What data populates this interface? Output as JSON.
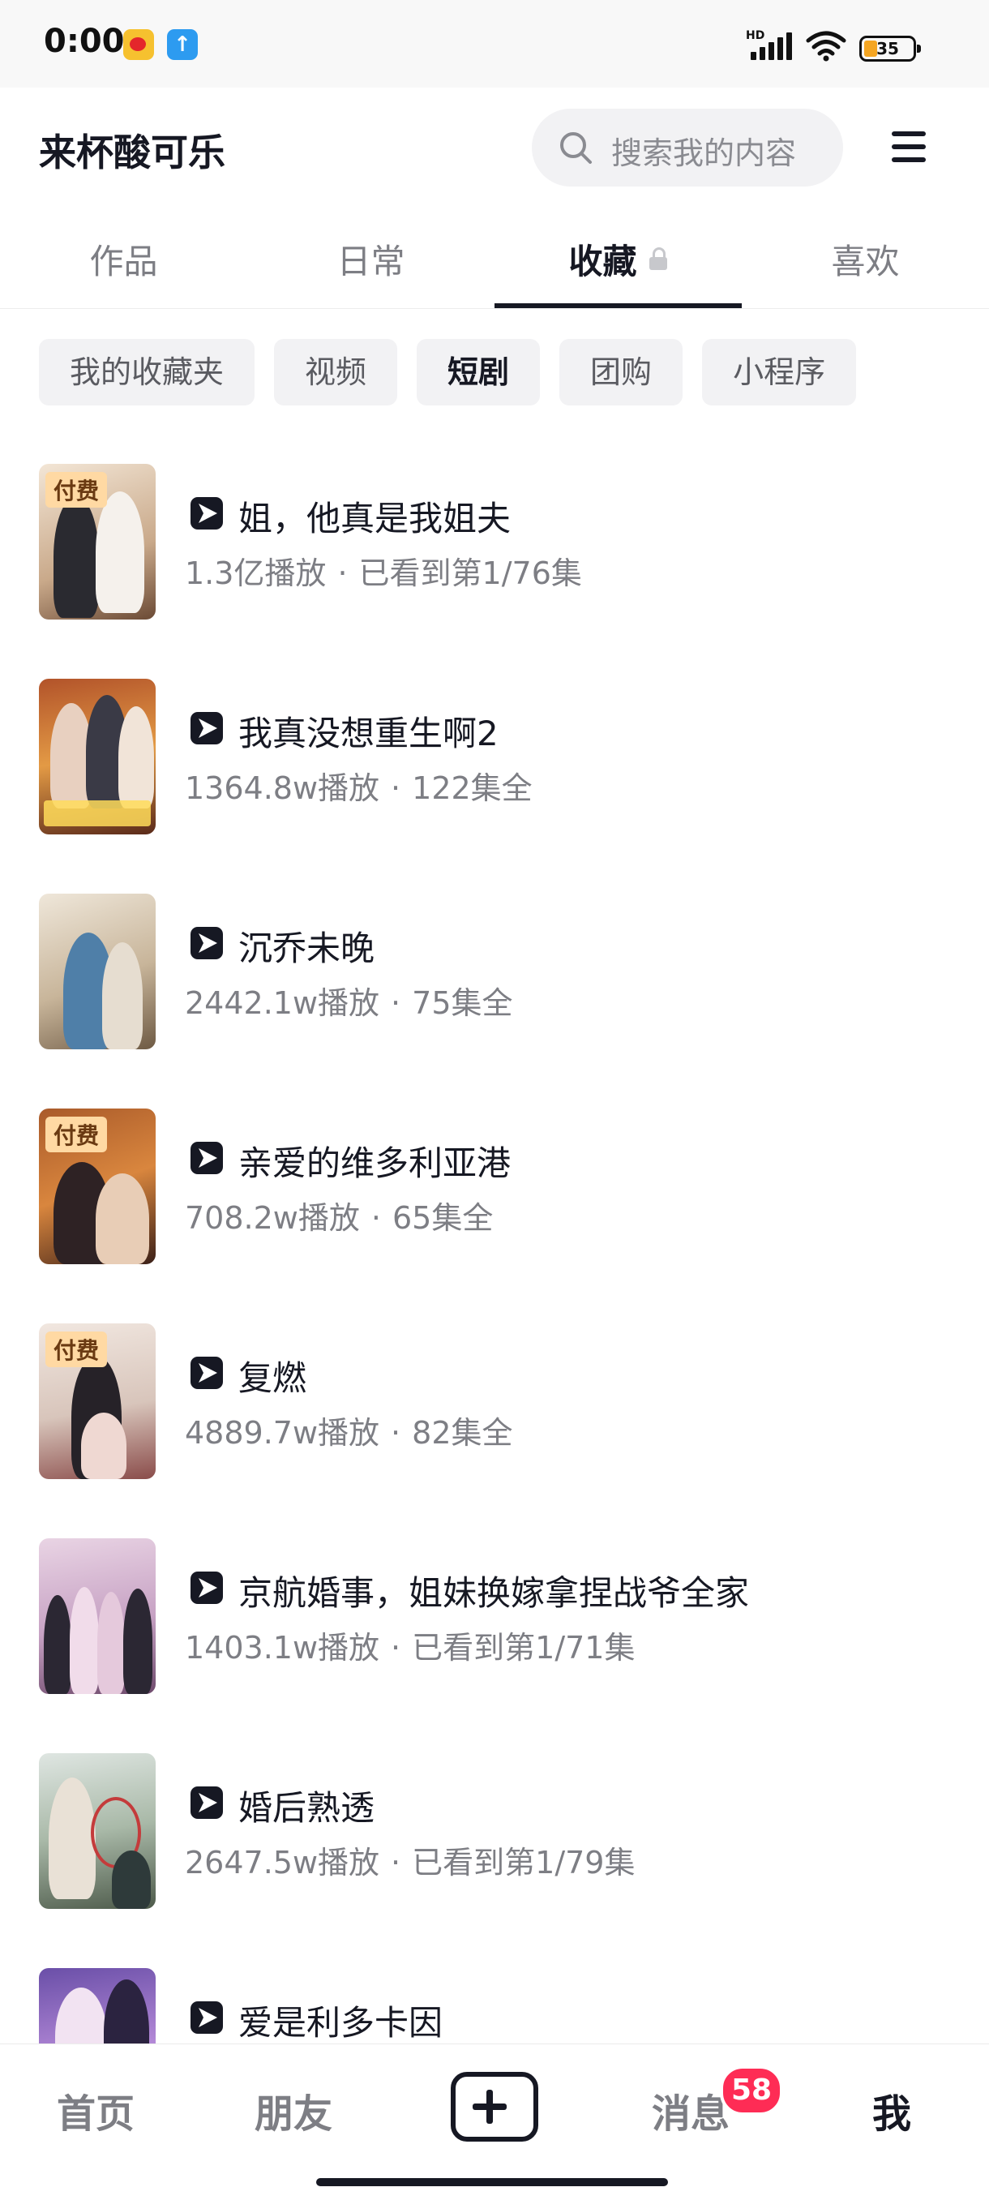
{
  "status_bar": {
    "time": "0:00",
    "network_label": "HD",
    "battery_level": "35",
    "icons": [
      "weibo-icon",
      "upload-icon",
      "signal-icon",
      "wifi-icon",
      "battery-icon"
    ]
  },
  "header": {
    "profile_name": "来杯酸可乐",
    "search_placeholder": "搜索我的内容",
    "menu_icon": "menu-icon"
  },
  "tabs": [
    {
      "label": "作品",
      "active": false
    },
    {
      "label": "日常",
      "active": false
    },
    {
      "label": "收藏",
      "active": true,
      "icon": "lock-icon"
    },
    {
      "label": "喜欢",
      "active": false
    }
  ],
  "filters": [
    {
      "label": "我的收藏夹",
      "selected": false
    },
    {
      "label": "视频",
      "selected": false
    },
    {
      "label": "短剧",
      "selected": true
    },
    {
      "label": "团购",
      "selected": false
    },
    {
      "label": "小程序",
      "selected": false
    }
  ],
  "paid_label": "付费",
  "meta_separator": "·",
  "dramas": [
    {
      "title": "姐，他真是我姐夫",
      "plays": "1.3亿播放",
      "progress": "已看到第1/76集",
      "paid": true
    },
    {
      "title": "我真没想重生啊2",
      "plays": "1364.8w播放",
      "progress": "122集全",
      "paid": false
    },
    {
      "title": "沉乔未晚",
      "plays": "2442.1w播放",
      "progress": "75集全",
      "paid": false
    },
    {
      "title": "亲爱的维多利亚港",
      "plays": "708.2w播放",
      "progress": "65集全",
      "paid": true
    },
    {
      "title": "复燃",
      "plays": "4889.7w播放",
      "progress": "82集全",
      "paid": true
    },
    {
      "title": "京航婚事，姐妹换嫁拿捏战爷全家",
      "plays": "1403.1w播放",
      "progress": "已看到第1/71集",
      "paid": false
    },
    {
      "title": "婚后熟透",
      "plays": "2647.5w播放",
      "progress": "已看到第1/79集",
      "paid": false
    },
    {
      "title": "爱是利多卡因",
      "plays": "",
      "progress": "",
      "paid": false
    }
  ],
  "bottom_nav": {
    "home": "首页",
    "friends": "朋友",
    "create_icon": "plus-icon",
    "messages": "消息",
    "messages_badge": "58",
    "me": "我"
  }
}
